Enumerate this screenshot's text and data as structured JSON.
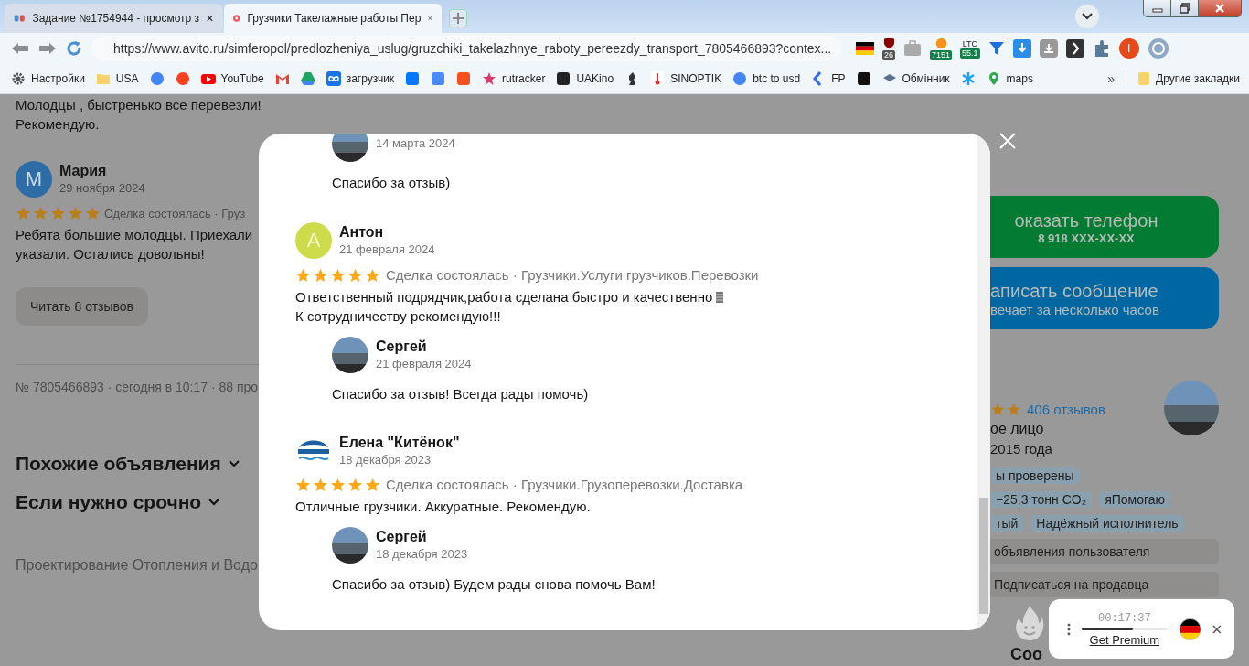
{
  "browser": {
    "tabs": [
      {
        "title": "Задание №1754944 - просмотр з",
        "selected": false
      },
      {
        "title": "Грузчики Такелажные работы Пер",
        "selected": true
      }
    ],
    "url": "https://www.avito.ru/simferopol/predlozheniya_uslug/gruzchiki_takelazhnye_raboty_pereezdy_transport_7805466893?contex...",
    "extensions": {
      "adblock_badge": "26",
      "btc_badge": "7151",
      "ltc_label": "LTC",
      "ltc_badge": "55.1",
      "profile_initial": "I"
    },
    "bookmarks": [
      {
        "kind": "link",
        "label": "Настройки"
      },
      {
        "kind": "link",
        "label": "USA"
      },
      {
        "kind": "icon"
      },
      {
        "kind": "icon"
      },
      {
        "kind": "link",
        "label": "YouTube"
      },
      {
        "kind": "icon"
      },
      {
        "kind": "icon"
      },
      {
        "kind": "link",
        "label": "загрузчик"
      },
      {
        "kind": "icon"
      },
      {
        "kind": "icon"
      },
      {
        "kind": "icon"
      },
      {
        "kind": "link",
        "label": "rutracker"
      },
      {
        "kind": "link",
        "label": "UAKino"
      },
      {
        "kind": "icon"
      },
      {
        "kind": "link",
        "label": "SINOPTIK"
      },
      {
        "kind": "link",
        "label": "btc to usd"
      },
      {
        "kind": "link",
        "label": "FP"
      },
      {
        "kind": "icon"
      },
      {
        "kind": "link",
        "label": "Обмінник"
      },
      {
        "kind": "icon"
      },
      {
        "kind": "link",
        "label": "maps"
      }
    ],
    "more_bookmarks": "»",
    "other_bookmarks": "Другие закладки"
  },
  "page": {
    "left": {
      "review_tail": [
        "Молодцы , быстренько все перевезли!",
        "Рекомендую."
      ],
      "review": {
        "avatar_letter": "М",
        "color": "#2e6ca6",
        "author": "Мария",
        "date": "29 ноября 2024",
        "stars": 5,
        "meta": "Сделка состоялась · Груз",
        "text": [
          "Ребята большие молодцы. Приехали",
          "указали. Остались довольны!"
        ]
      },
      "read_button": "Читать 8 отзывов",
      "ad_info": "№ 7805466893 · сегодня в 10:17 · 88 про",
      "sections": [
        {
          "title": "Похожие объявления",
          "expanded": false
        },
        {
          "title": "Если нужно срочно",
          "expanded": false
        }
      ],
      "related_link": "Проектирование Отопления и Водо"
    },
    "right": {
      "phone_button": {
        "label": "оказать телефон",
        "number": "8 918 XXX-XX-XX"
      },
      "message_button": {
        "label": "аписать сообщение",
        "note": "вечает за несколько часов"
      },
      "seller": {
        "reviews_link": "406 отзывов",
        "type": "ое лицо",
        "since": "2015 года"
      },
      "tags": [
        [
          "ы проверены"
        ],
        [
          "−25,3 тонн CO₂",
          "яПомогаю"
        ],
        [
          "тый",
          "Надёжный исполнитель"
        ]
      ],
      "actions": [
        "объявления пользователя",
        "Подписаться на продавца"
      ],
      "cut_heading": "Соо"
    }
  },
  "modal": {
    "top_reply": {
      "date": "14 марта 2024",
      "text": "Спасибо за отзыв)"
    },
    "reviews": [
      {
        "kind": "letter",
        "avatar_letter": "А",
        "color": "#cddc4a",
        "author": "Антон",
        "date": "21 февраля 2024",
        "stars": 5,
        "meta": "Сделка состоялась · Грузчики.Услуги грузчиков.Перевозки",
        "text": [
          "Ответственный подрядчик,работа сделана быстро и качественно",
          "К сотрудничеству рекомендую!!!"
        ],
        "emoji_after_first_line": true,
        "reply": {
          "author": "Сергей",
          "date": "21 февраля 2024",
          "text": "Спасибо за отзыв! Всегда рады помочь)"
        }
      },
      {
        "kind": "logo",
        "author": "Елена \"Китёнок\"",
        "date": "18 декабря 2023",
        "stars": 5,
        "meta": "Сделка состоялась · Грузчики.Грузоперевозки.Доставка",
        "text": [
          "Отличные грузчики. Аккуратные. Рекомендую."
        ],
        "emoji_after_first_line": false,
        "reply": {
          "author": "Сергей",
          "date": "18 декабря 2023",
          "text": "Спасибо за отзыв) Будем рады снова помочь Вам!"
        }
      }
    ]
  },
  "vpn_widget": {
    "timer": "00:17:37",
    "level": 0.6,
    "link": "Get Premium"
  }
}
